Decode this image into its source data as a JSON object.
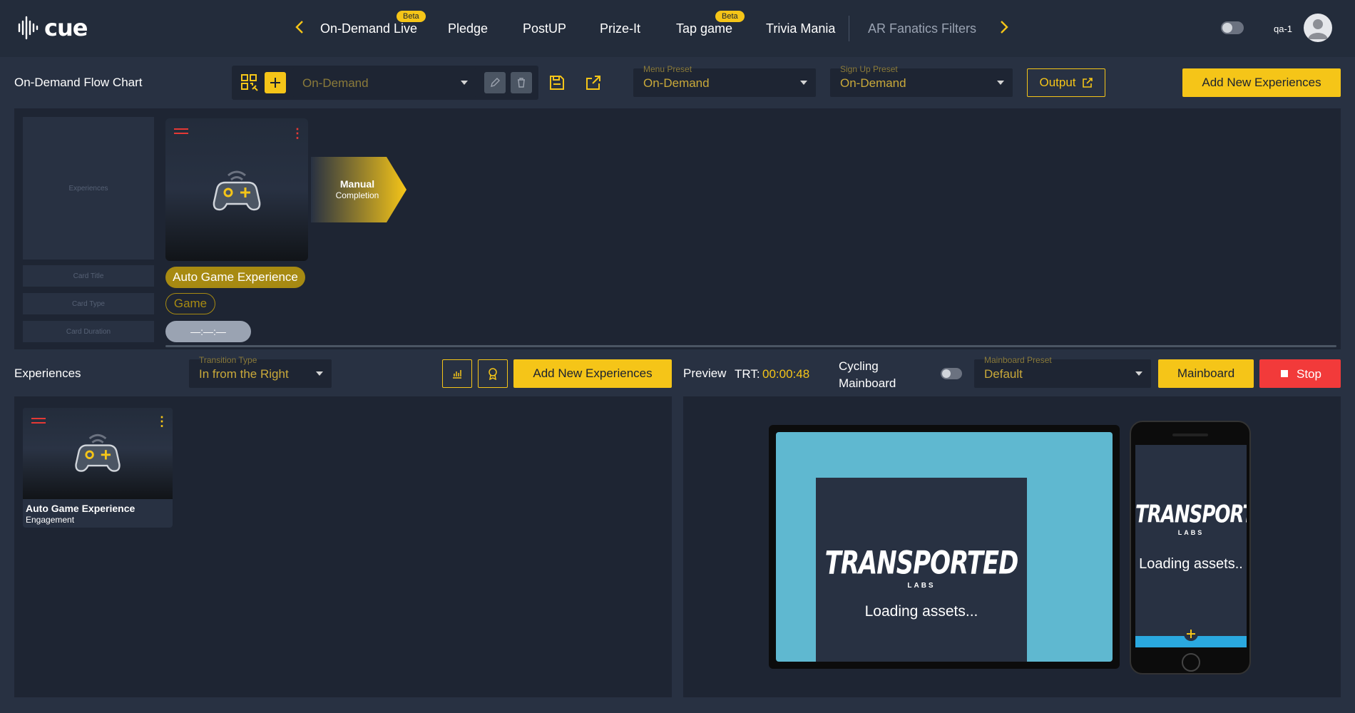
{
  "app": {
    "logo_text": "cue"
  },
  "nav": {
    "items": [
      {
        "label": "On-Demand Live",
        "badge": "Beta"
      },
      {
        "label": "Pledge"
      },
      {
        "label": "PostUP"
      },
      {
        "label": "Prize-It"
      },
      {
        "label": "Tap game",
        "badge": "Beta"
      },
      {
        "label": "Trivia Mania"
      },
      {
        "label": "AR Fanatics Filters"
      }
    ]
  },
  "user": {
    "name": "qa-1"
  },
  "flow": {
    "title": "On-Demand Flow Chart",
    "flow_select": "On-Demand",
    "menu_preset": {
      "label": "Menu Preset",
      "value": "On-Demand"
    },
    "signup_preset": {
      "label": "Sign Up Preset",
      "value": "On-Demand"
    },
    "output_label": "Output",
    "add_label": "Add New Experiences",
    "placeholders": {
      "experiences": "Experiences",
      "card_title": "Card Title",
      "card_type": "Card Type",
      "card_duration": "Card Duration"
    },
    "card": {
      "title": "Auto Game Experience",
      "type": "Game",
      "duration": "—:—:—"
    },
    "completion": {
      "line1": "Manual",
      "line2": "Completion"
    }
  },
  "experiences": {
    "title": "Experiences",
    "transition": {
      "label": "Transition Type",
      "value": "In from the Right"
    },
    "add_label": "Add New Experiences",
    "items": [
      {
        "title": "Auto Game Experience",
        "subtitle": "Engagement"
      }
    ]
  },
  "preview": {
    "label": "Preview",
    "trt_label": "TRT:",
    "trt_value": "00:00:48",
    "cycling_line1": "Cycling",
    "cycling_line2": "Mainboard",
    "mainboard_preset": {
      "label": "Mainboard Preset",
      "value": "Default"
    },
    "mainboard_label": "Mainboard",
    "stop_label": "Stop",
    "brand_name": "TRANSPORTED",
    "brand_sub": "LABS",
    "tablet_loading": "Loading assets...",
    "phone_loading": "Loading assets.."
  },
  "colors": {
    "accent": "#f5c518",
    "danger": "#f23a3a",
    "background": "#283142",
    "panel": "#1e2533",
    "preview_bg": "#5fb8d0"
  }
}
